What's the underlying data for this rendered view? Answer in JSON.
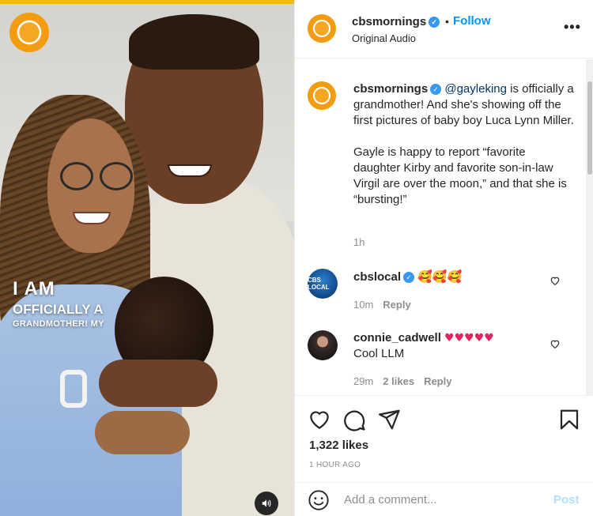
{
  "media": {
    "overlay_line1": "I AM",
    "overlay_line2": "OFFICIALLY A",
    "overlay_line3": "GRANDMOTHER! MY",
    "audio_icon": "speaker-icon",
    "brand_color": "#f39c12"
  },
  "header": {
    "username": "cbsmornings",
    "verified": "✓",
    "separator": "•",
    "follow_label": "Follow",
    "subtitle": "Original Audio",
    "more_icon": "•••"
  },
  "caption": {
    "username": "cbsmornings",
    "mention": "@gayleking",
    "text_part1": " is officially a grandmother! And she's showing off the first pictures of baby boy Luca Lynn Miller.",
    "text_part2": "Gayle is happy to report “favorite daughter Kirby and favorite son-in-law Virgil are over the moon,” and that she is “bursting!”",
    "time": "1h"
  },
  "comments": [
    {
      "username": "cbslocal",
      "avatar_text": "CBS LOCAL",
      "emojis": "🥰🥰🥰",
      "time": "10m",
      "likes": "",
      "reply_label": "Reply"
    },
    {
      "username": "connie_cadwell",
      "emojis": "♥♥♥♥♥",
      "text": "Cool LLM",
      "time": "29m",
      "likes": "2 likes",
      "reply_label": "Reply"
    }
  ],
  "actions": {
    "likes": "1,322 likes",
    "timestamp": "1 HOUR AGO"
  },
  "composer": {
    "placeholder": "Add a comment...",
    "post_label": "Post"
  },
  "colors": {
    "link": "#0095f6",
    "verified": "#3897f0",
    "muted": "#8e8e8e",
    "post_disabled": "#b2dffc"
  }
}
